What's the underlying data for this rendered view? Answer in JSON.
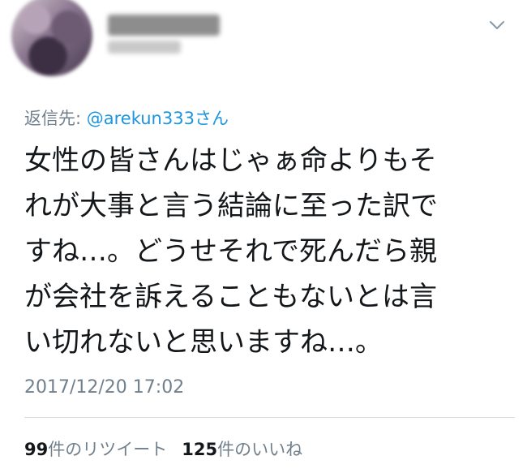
{
  "reply": {
    "prefix": "返信先: ",
    "mention": "@arekun333さん"
  },
  "body": {
    "lines": [
      "女性の皆さんはじゃぁ命よりもそ",
      "れが大事と言う結論に至った訳で",
      "すね…。どうせそれで死んだら親",
      "が会社を訴えることもないとは言",
      "い切れないと思いますね…。"
    ]
  },
  "timestamp": "2017/12/20 17:02",
  "stats": {
    "retweets_count": "99",
    "retweets_label": "件のリツイート",
    "likes_count": "125",
    "likes_label": "件のいいね"
  },
  "icons": {
    "menu": "chevron-down-icon"
  },
  "colors": {
    "mention": "#1b95e0",
    "muted": "#71808c",
    "text": "#14171a"
  }
}
